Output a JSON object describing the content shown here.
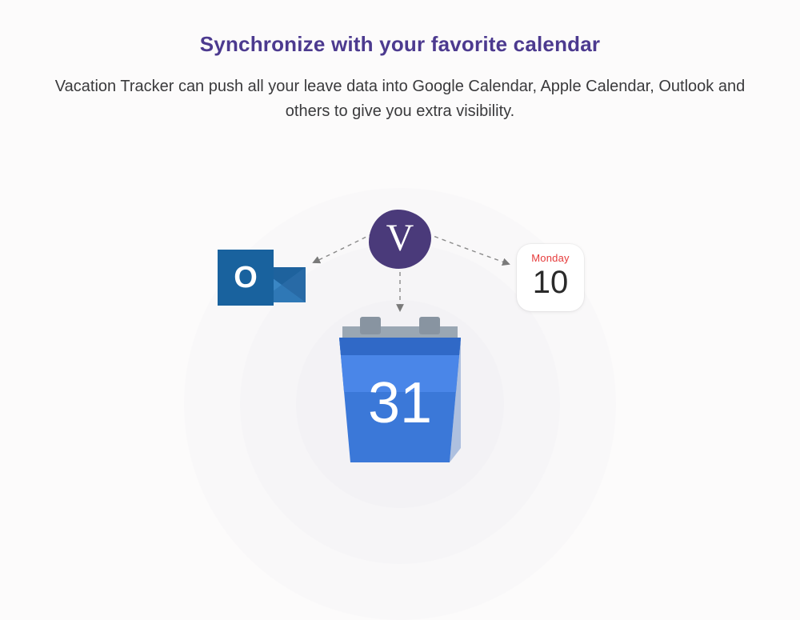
{
  "heading": "Synchronize with your favorite calendar",
  "subheading": "Vacation Tracker can push all your leave data into Google Calendar, Apple Calendar, Outlook and others to give you extra visibility.",
  "logo_letter": "V",
  "outlook_letter": "O",
  "apple_calendar": {
    "day_label": "Monday",
    "day_number": "10"
  },
  "google_calendar_number": "31"
}
